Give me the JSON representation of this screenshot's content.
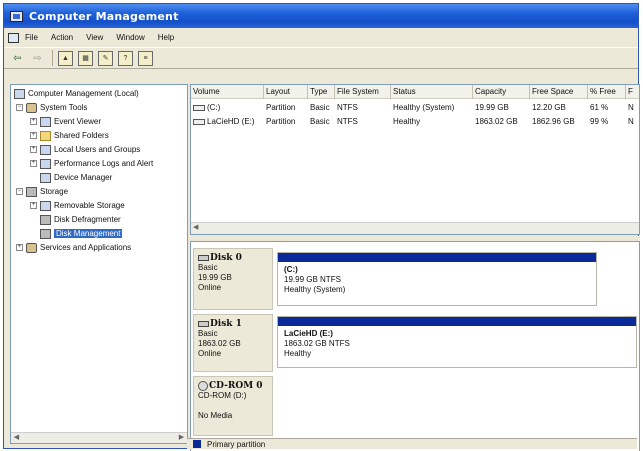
{
  "window": {
    "title": "Computer Management"
  },
  "menu": [
    "File",
    "Action",
    "View",
    "Window",
    "Help"
  ],
  "toolbar": {
    "icons": [
      "back-arrow-icon",
      "forward-arrow-icon",
      "up-folder-icon",
      "show-hide-tree-icon",
      "properties-icon",
      "help-icon",
      "export-icon"
    ]
  },
  "tree": {
    "root": "Computer Management (Local)",
    "system_tools": "System Tools",
    "event_viewer": "Event Viewer",
    "shared_folders": "Shared Folders",
    "local_users": "Local Users and Groups",
    "perf_logs": "Performance Logs and Alert",
    "device_manager": "Device Manager",
    "storage": "Storage",
    "removable_storage": "Removable Storage",
    "disk_defrag": "Disk Defragmenter",
    "disk_management": "Disk Management",
    "services": "Services and Applications"
  },
  "volumes": {
    "columns": [
      "Volume",
      "Layout",
      "Type",
      "File System",
      "Status",
      "Capacity",
      "Free Space",
      "% Free",
      "F"
    ],
    "rows": [
      [
        "(C:)",
        "Partition",
        "Basic",
        "NTFS",
        "Healthy (System)",
        "19.99 GB",
        "12.20 GB",
        "61 %",
        "N"
      ],
      [
        "LaCieHD (E:)",
        "Partition",
        "Basic",
        "NTFS",
        "Healthy",
        "1863.02 GB",
        "1862.96 GB",
        "99 %",
        "N"
      ]
    ]
  },
  "disks": [
    {
      "name": "Disk 0",
      "type": "Basic",
      "size": "19.99 GB",
      "state": "Online",
      "partition": {
        "name": "(C:)",
        "detail": "19.99 GB NTFS",
        "status": "Healthy (System)"
      }
    },
    {
      "name": "Disk 1",
      "type": "Basic",
      "size": "1863.02 GB",
      "state": "Online",
      "partition": {
        "name": "LaCieHD (E:)",
        "detail": "1863.02 GB NTFS",
        "status": "Healthy"
      }
    },
    {
      "name": "CD-ROM 0",
      "type": "CD-ROM (D:)",
      "size": "",
      "state": "No Media"
    }
  ],
  "legend": {
    "primary": "Primary partition",
    "primary_color": "#0a2a9a"
  }
}
